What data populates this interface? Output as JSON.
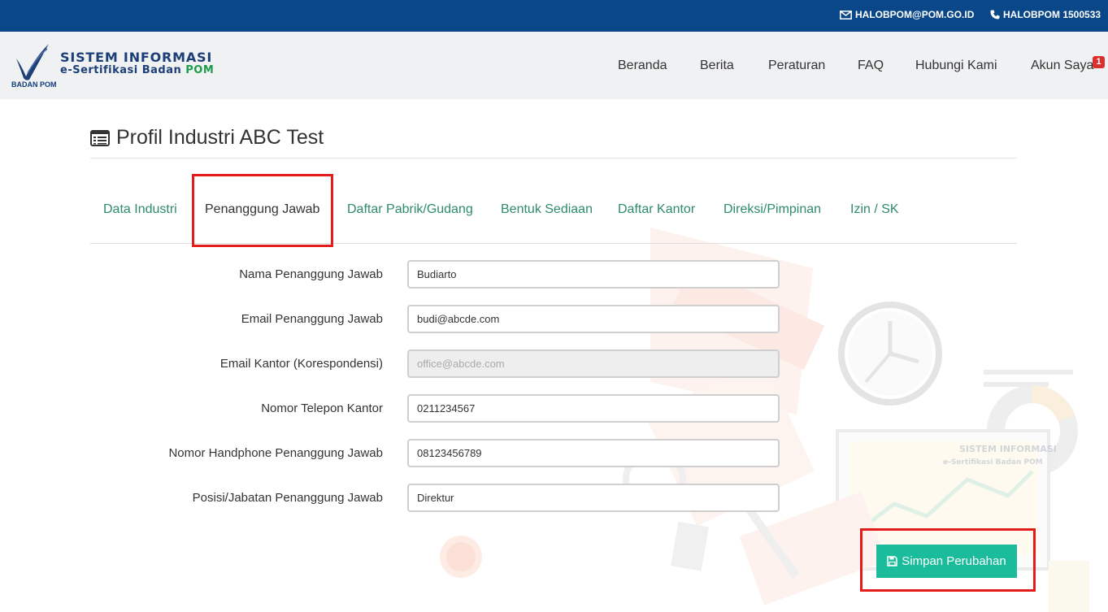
{
  "topbar": {
    "email": "HALOBPOM@POM.GO.ID",
    "phone": "HALOBPOM 1500533"
  },
  "brand": {
    "logo_text": "BADAN POM",
    "line1": "SISTEM INFORMASI",
    "line2_prefix": "e-Sertifikasi Badan ",
    "line2_suffix": "POM"
  },
  "nav": {
    "items": [
      "Beranda",
      "Berita",
      "Peraturan",
      "FAQ",
      "Hubungi Kami",
      "Akun Saya"
    ],
    "badge": "1"
  },
  "page": {
    "title": "Profil Industri ABC Test"
  },
  "tabs": [
    "Data Industri",
    "Penanggung Jawab",
    "Daftar Pabrik/Gudang",
    "Bentuk Sediaan",
    "Daftar Kantor",
    "Direksi/Pimpinan",
    "Izin / SK"
  ],
  "active_tab": "Penanggung Jawab",
  "form": {
    "fields": [
      {
        "label": "Nama Penanggung Jawab",
        "value": "Budiarto"
      },
      {
        "label": "Email Penanggung Jawab",
        "value": "budi@abcde.com"
      },
      {
        "label": "Email Kantor (Korespondensi)",
        "value": "office@abcde.com",
        "disabled": true
      },
      {
        "label": "Nomor Telepon Kantor",
        "value": "0211234567"
      },
      {
        "label": "Nomor Handphone Penanggung Jawab",
        "value": "08123456789"
      },
      {
        "label": "Posisi/Jabatan Penanggung Jawab",
        "value": "Direktur"
      }
    ],
    "save_label": "Simpan Perubahan"
  },
  "background_watermark": {
    "line1": "SISTEM INFORMASI",
    "line2": "e-Sertifikasi Badan POM"
  },
  "colors": {
    "topbar": "#0a4788",
    "header": "#eff1f3",
    "tab_link": "#2e8b6e",
    "save_button": "#1bbc9b",
    "highlight": "#e31b1b",
    "badge": "#d9302f"
  }
}
